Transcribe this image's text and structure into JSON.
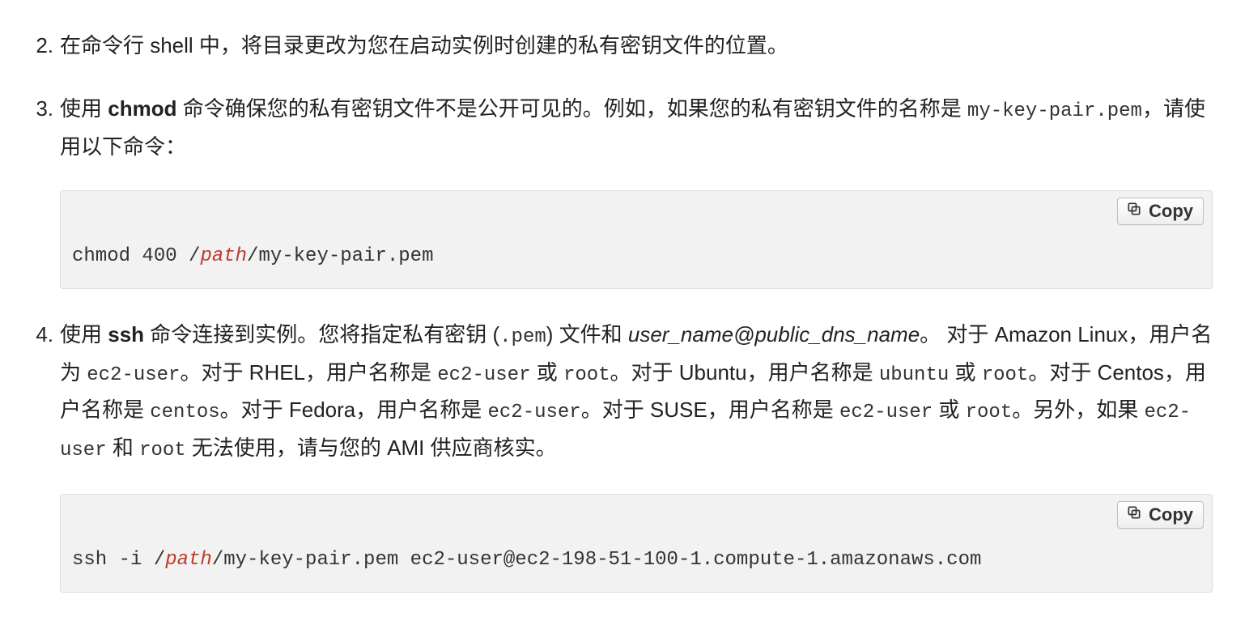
{
  "copy_label": "Copy",
  "steps": {
    "2": {
      "num": "2.",
      "text": "在命令行 shell 中，将目录更改为您在启动实例时创建的私有密钥文件的位置。"
    },
    "3": {
      "num": "3.",
      "t1": "使用 ",
      "cmd": "chmod",
      "t2": " 命令确保您的私有密钥文件不是公开可见的。例如，如果您的私有密钥文件的名称是 ",
      "filename": "my-key-pair.pem",
      "t3": "，请使用以下命令：",
      "code": {
        "a": "chmod 400 /",
        "repl": "path",
        "b": "/my-key-pair.pem"
      }
    },
    "4": {
      "num": "4.",
      "t1": "使用 ",
      "cmd": "ssh",
      "t2": " 命令连接到实例。您将指定私有密钥 (",
      "ext": ".pem",
      "t3": ") 文件和 ",
      "userhost": "user_name@public_dns_name",
      "t4": "。 对于 Amazon Linux，用户名为 ",
      "u1": "ec2-user",
      "t5": "。对于 RHEL，用户名称是 ",
      "u2": "ec2-user",
      "t6": " 或 ",
      "u3": "root",
      "t7": "。对于 Ubuntu，用户名称是 ",
      "u4": "ubuntu",
      "t8": " 或 ",
      "u5": "root",
      "t9": "。对于 Centos，用户名称是 ",
      "u6": "centos",
      "t10": "。对于 Fedora，用户名称是 ",
      "u7": "ec2-user",
      "t11": "。对于 SUSE，用户名称是 ",
      "u8": "ec2-user",
      "t12": " 或 ",
      "u9": "root",
      "t13": "。另外，如果 ",
      "u10": "ec2-user",
      "t14": " 和 ",
      "u11": "root",
      "t15": " 无法使用，请与您的 AMI 供应商核实。",
      "code": {
        "a": "ssh -i /",
        "repl": "path",
        "b": "/my-key-pair.pem ec2-user@ec2-198-51-100-1.compute-1.amazonaws.com"
      }
    }
  }
}
